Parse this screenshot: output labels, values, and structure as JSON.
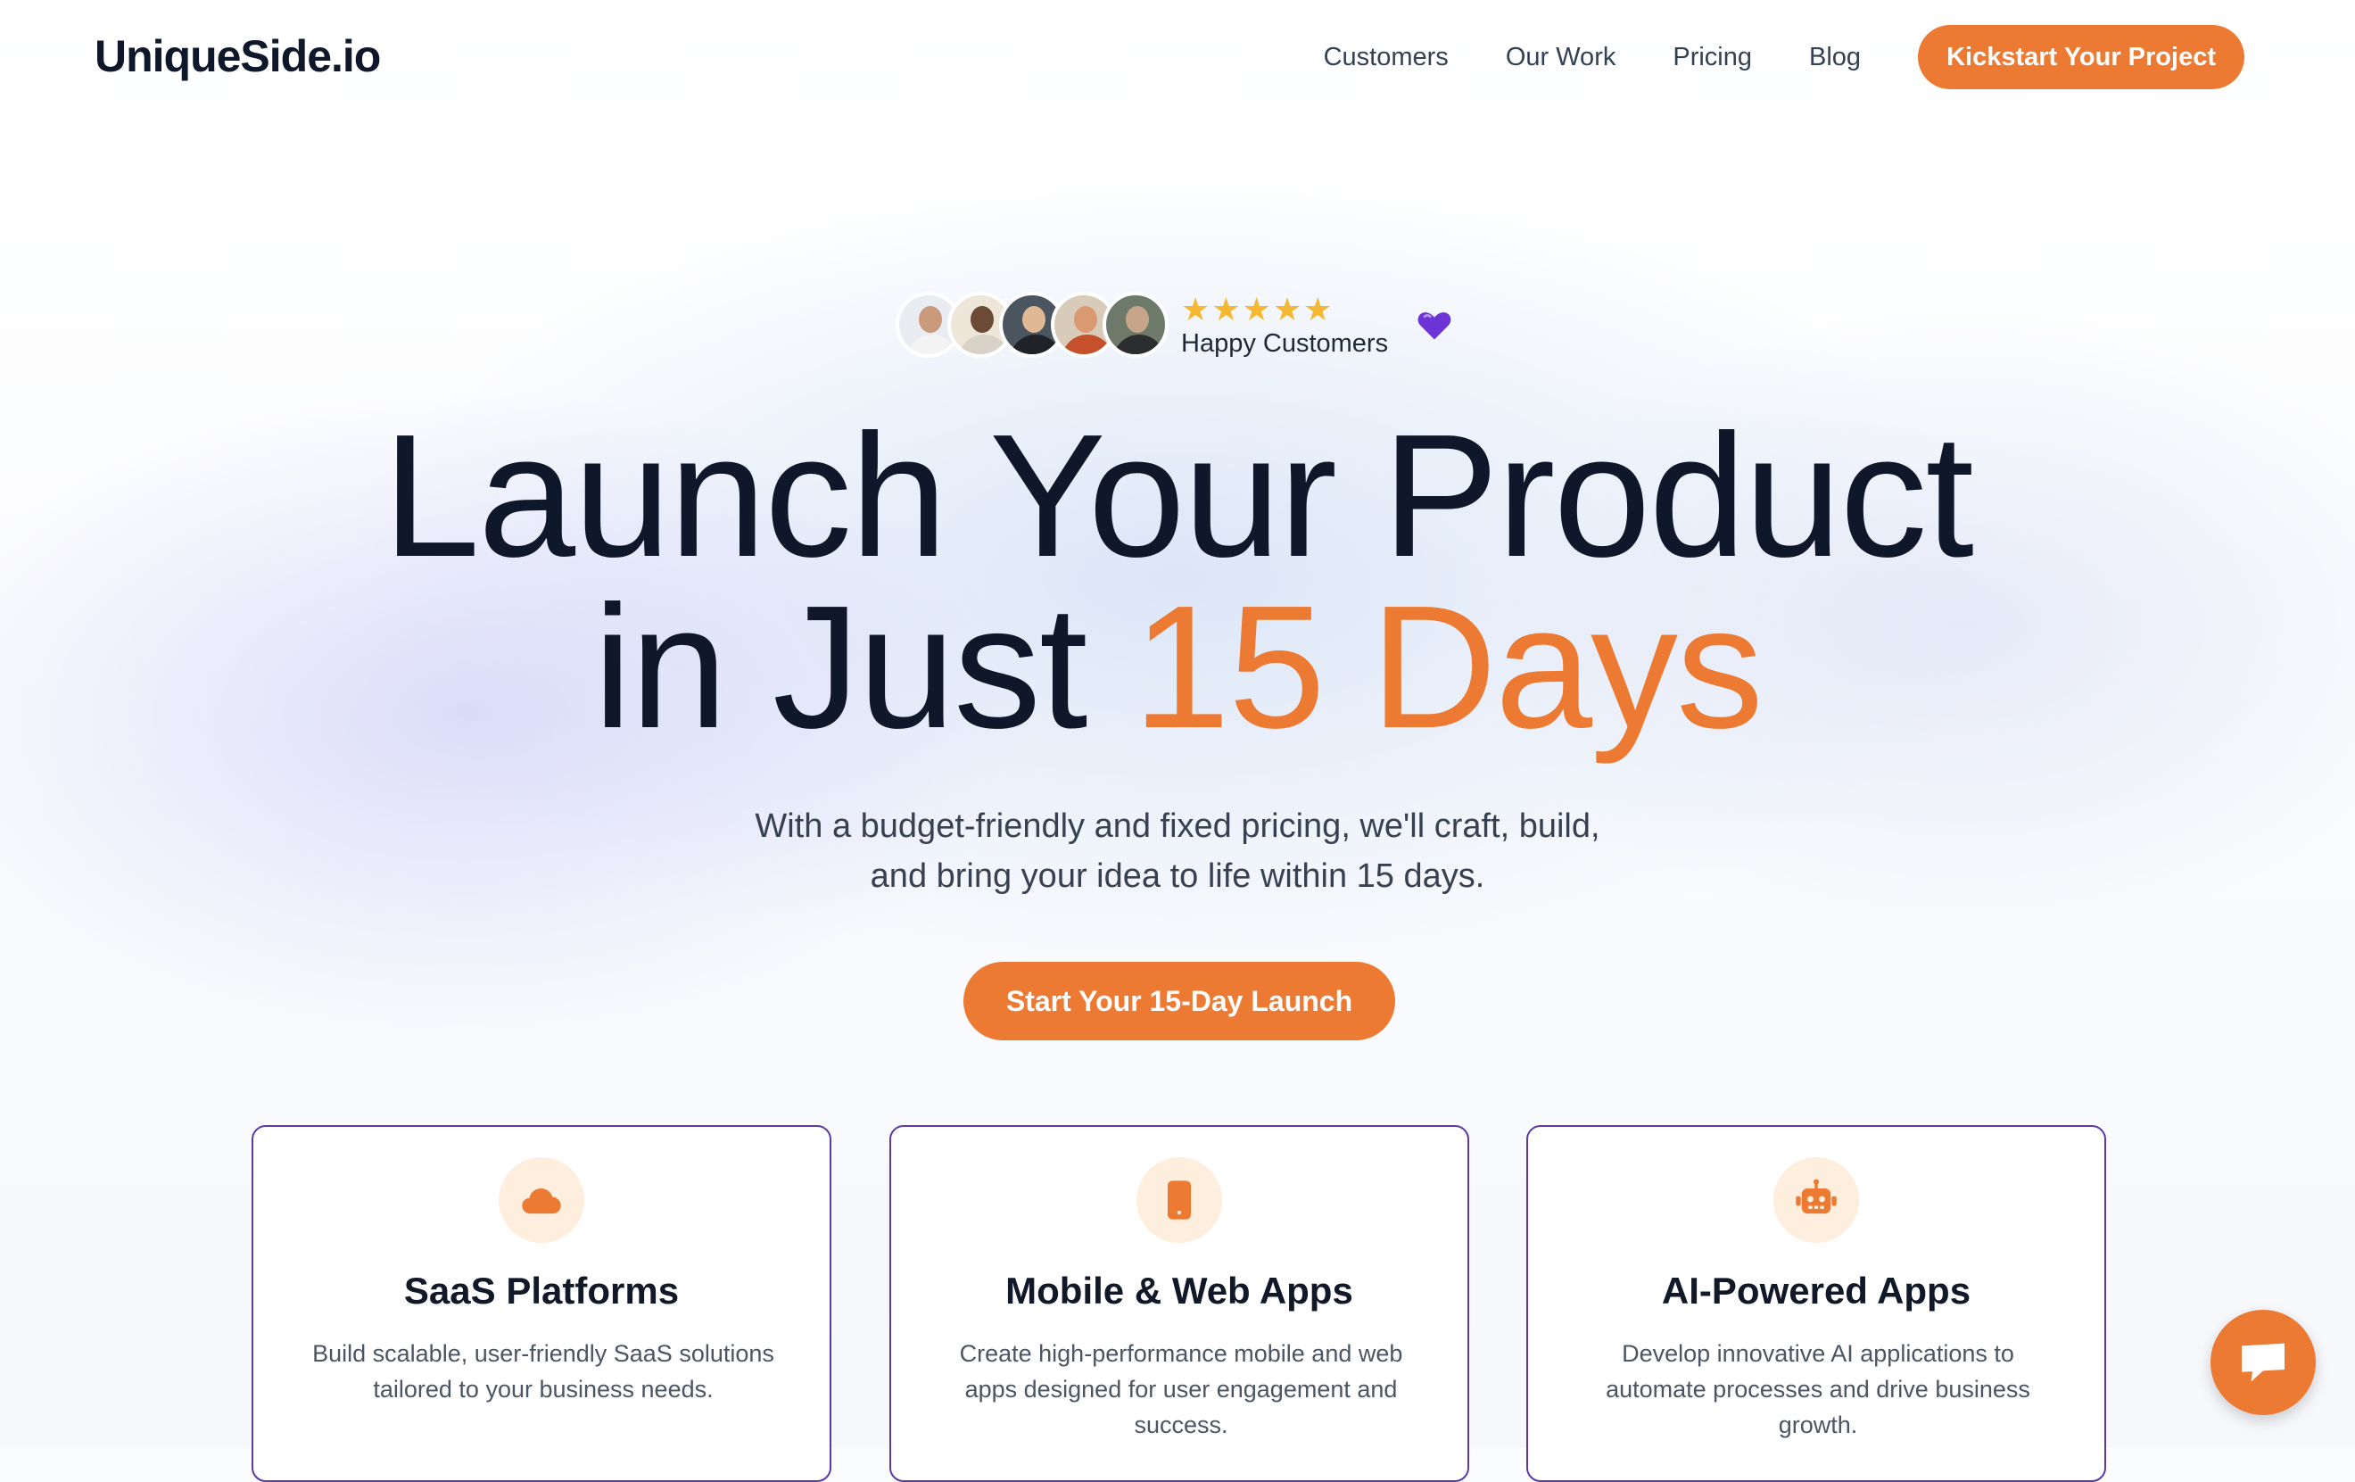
{
  "header": {
    "logo": "UniqueSide.io",
    "nav": [
      {
        "label": "Customers"
      },
      {
        "label": "Our Work"
      },
      {
        "label": "Pricing"
      },
      {
        "label": "Blog"
      }
    ],
    "cta_label": "Kickstart Your Project"
  },
  "social_proof": {
    "stars": "★★★★★",
    "label": "Happy Customers",
    "avatar_count": 5
  },
  "hero": {
    "title_line1": "Launch Your Product",
    "title_line2_prefix": "in Just ",
    "title_line2_accent": "15 Days",
    "subtitle_line1": "With a budget-friendly and fixed pricing, we'll craft, build,",
    "subtitle_line2": "and bring your idea to life within 15 days.",
    "cta_label": "Start Your 15-Day Launch"
  },
  "cards": [
    {
      "icon": "cloud-icon",
      "title": "SaaS Platforms",
      "desc": "Build scalable, user-friendly SaaS solutions tailored to your business needs."
    },
    {
      "icon": "mobile-icon",
      "title": "Mobile & Web Apps",
      "desc": "Create high-performance mobile and web apps designed for user engagement and success."
    },
    {
      "icon": "robot-icon",
      "title": "AI-Powered Apps",
      "desc": "Develop innovative AI applications to automate processes and drive business growth."
    }
  ],
  "chat": {
    "icon": "chat-icon"
  },
  "colors": {
    "accent": "#ec7a32",
    "heading": "#0f172a",
    "card_border": "#5b3aa6",
    "heart": "#6d35d6",
    "star": "#f5b832"
  }
}
